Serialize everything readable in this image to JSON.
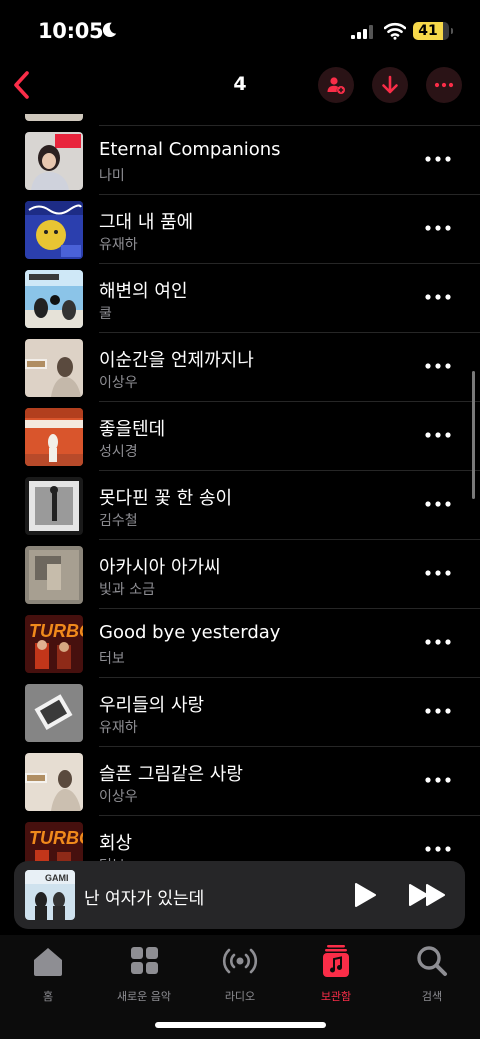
{
  "status_bar": {
    "time": "10:05",
    "battery": "41"
  },
  "nav": {
    "title": "4"
  },
  "songs": [
    {
      "title": "Eternal Companions",
      "artist": "나미"
    },
    {
      "title": "그대 내 품에",
      "artist": "유재하"
    },
    {
      "title": "해변의 여인",
      "artist": "쿨"
    },
    {
      "title": "이순간을 언제까지나",
      "artist": "이상우"
    },
    {
      "title": "좋을텐데",
      "artist": "성시경"
    },
    {
      "title": "못다핀 꽃 한 송이",
      "artist": "김수철"
    },
    {
      "title": "아카시아 아가씨",
      "artist": "빛과 소금"
    },
    {
      "title": "Good bye yesterday",
      "artist": "터보"
    },
    {
      "title": "우리들의 사랑",
      "artist": "유재하"
    },
    {
      "title": "슬픈 그림같은 사랑",
      "artist": "이상우"
    },
    {
      "title": "회상",
      "artist": "터보"
    }
  ],
  "now_playing": {
    "title": "난 여자가 있는데"
  },
  "tabs": [
    {
      "label": "홈",
      "icon": "home-icon"
    },
    {
      "label": "새로운 음악",
      "icon": "grid-icon"
    },
    {
      "label": "라디오",
      "icon": "radio-icon"
    },
    {
      "label": "보관함",
      "icon": "library-icon",
      "active": true
    },
    {
      "label": "검색",
      "icon": "search-icon"
    }
  ],
  "colors": {
    "accent": "#fa2d48",
    "background": "#000000",
    "secondary_text": "#8e8e93"
  }
}
